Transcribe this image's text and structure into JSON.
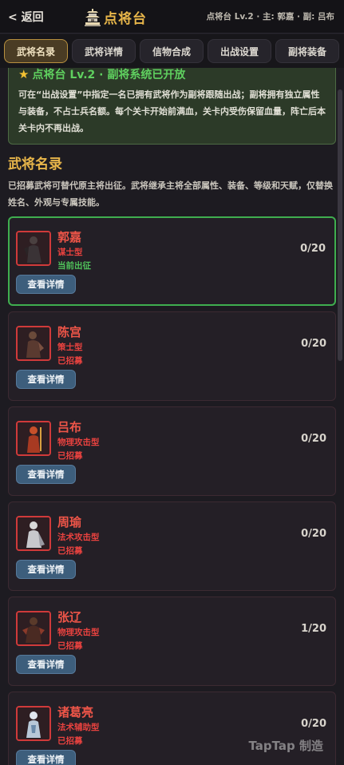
{
  "header": {
    "back_label": "< 返回",
    "title": "点将台",
    "info": "点将台 Lv.2 · 主: 郭嘉 · 副: 吕布"
  },
  "tabs": [
    {
      "label": "武将名录",
      "active": true
    },
    {
      "label": "武将详情",
      "active": false
    },
    {
      "label": "信物合成",
      "active": false
    },
    {
      "label": "出战设置",
      "active": false
    },
    {
      "label": "副将装备",
      "active": false
    }
  ],
  "notice": {
    "title": "点将台 Lv.2 · 副将系统已开放",
    "body": "可在“出战设置”中指定一名已拥有武将作为副将跟随出战；副将拥有独立属性与装备，不占士兵名额。每个关卡开始前满血，关卡内受伤保留血量，阵亡后本关卡内不再出战。"
  },
  "section": {
    "title": "武将名录",
    "desc": "已招募武将可替代原主将出征。武将继承主将全部属性、装备、等级和天赋，仅替换姓名、外观与专属技能。"
  },
  "heroes": [
    {
      "name": "郭嘉",
      "type": "谋士型",
      "status": "当前出征",
      "count": "0/20",
      "button": "查看详情",
      "current": true
    },
    {
      "name": "陈宫",
      "type": "策士型",
      "status": "已招募",
      "count": "0/20",
      "button": "查看详情",
      "current": false
    },
    {
      "name": "吕布",
      "type": "物理攻击型",
      "status": "已招募",
      "count": "0/20",
      "button": "查看详情",
      "current": false
    },
    {
      "name": "周瑜",
      "type": "法术攻击型",
      "status": "已招募",
      "count": "0/20",
      "button": "查看详情",
      "current": false
    },
    {
      "name": "张辽",
      "type": "物理攻击型",
      "status": "已招募",
      "count": "1/20",
      "button": "查看详情",
      "current": false
    },
    {
      "name": "诸葛亮",
      "type": "法术辅助型",
      "status": "已招募",
      "count": "0/20",
      "button": "查看详情",
      "current": false
    }
  ],
  "watermark": "TapTap 制造",
  "colors": {
    "accent_gold": "#e8b64a",
    "hero_red": "#ee5548",
    "active_green": "#4fc25a",
    "button_blue": "#3d5e7c"
  }
}
